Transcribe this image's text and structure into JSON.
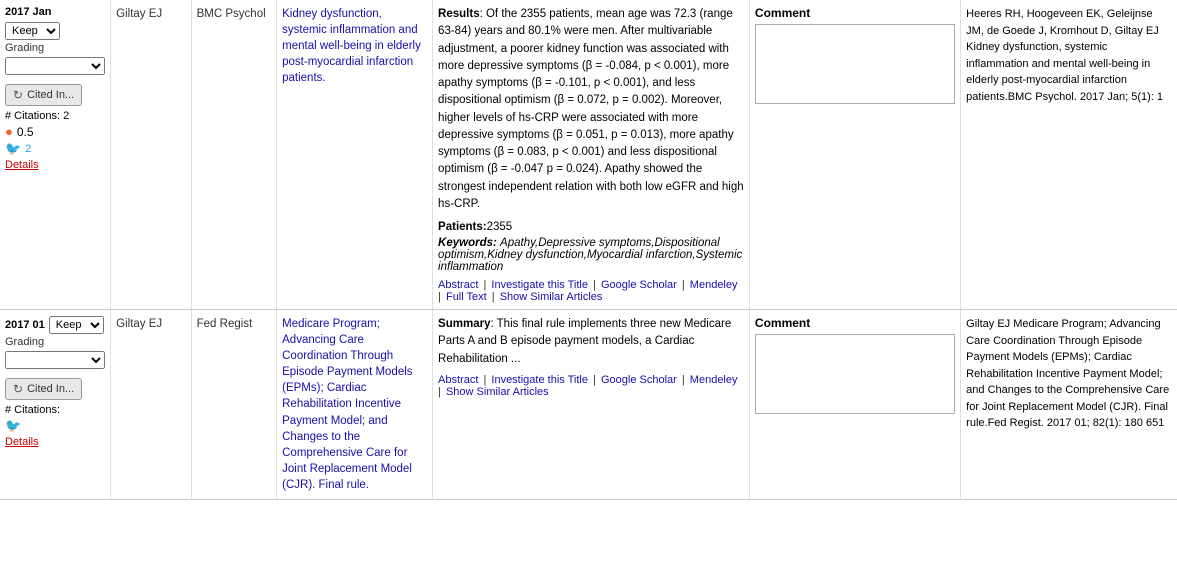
{
  "rows": [
    {
      "id": "row1",
      "date": "2017 Jan",
      "grading_label": "Grading",
      "keep_option": "Keep",
      "cited_btn": "Cited In...",
      "citations_count_label": "# Citations: 2",
      "score": "0.5",
      "twitter_count": "2",
      "details_label": "Details",
      "author": "Giltay EJ",
      "journal": "BMC Psychol",
      "title": "Kidney dysfunction, systemic inflammation and mental well-being in elderly post-myocardial infarction patients.",
      "summary_label": "Results",
      "summary_prefix": "Results",
      "summary_body": ": Of the 2355 patients, mean age was 72.3 (range 63-84) years and 80.1% were men. After multivariable adjustment, a poorer kidney function was associated with more depressive symptoms (β = -0.084, p < 0.001), more apathy symptoms (β = -0.101, p < 0.001), and less dispositional optimism (β = 0.072, p = 0.002). Moreover, higher levels of hs-CRP were associated with more depressive symptoms (β = 0.051, p = 0.013), more apathy symptoms (β = 0.083, p < 0.001) and less dispositional optimism (β = -0.047 p = 0.024). Apathy showed the strongest independent relation with both low eGFR and high hs-CRP.",
      "patients_label": "Patients:",
      "patients_value": "2355",
      "keywords_label": "Keywords:",
      "keywords_value": "Apathy,Depressive symptoms,Dispositional optimism,Kidney dysfunction,Myocardial infarction,Systemic inflammation",
      "links": [
        "Abstract",
        "Investigate this Title",
        "Google Scholar",
        "Mendeley",
        "Full Text"
      ],
      "show_similar": "Show Similar Articles",
      "comment_label": "Comment",
      "comment_placeholder": "",
      "citation_text": "Heeres RH, Hoogeveen EK, Geleijnse JM, de Goede J, Kromhout D, Giltay EJ Kidney dysfunction, systemic inflammation and mental well-being in elderly post-myocardial infarction patients.BMC Psychol. 2017 Jan; 5(1): 1"
    },
    {
      "id": "row2",
      "date": "2017 01",
      "grading_label": "Grading",
      "keep_option": "Keep",
      "cited_btn": "Cited In...",
      "citations_count_label": "# Citations:",
      "score": "",
      "twitter_count": "",
      "details_label": "Details",
      "author": "Giltay EJ",
      "journal": "Fed Regist",
      "title": "Medicare Program; Advancing Care Coordination Through Episode Payment Models (EPMs); Cardiac Rehabilitation Incentive Payment Model; and Changes to the Comprehensive Care for Joint Replacement Model (CJR). Final rule.",
      "summary_prefix": "Summary",
      "summary_body": ": This final rule implements three new Medicare Parts A and B episode payment models, a Cardiac Rehabilitation ...",
      "patients_label": "",
      "patients_value": "",
      "keywords_label": "",
      "keywords_value": "",
      "links": [
        "Abstract",
        "Investigate this Title",
        "Google Scholar",
        "Mendeley"
      ],
      "show_similar": "Show Similar Articles",
      "comment_label": "Comment",
      "comment_placeholder": "",
      "citation_text": "Giltay EJ Medicare Program; Advancing Care Coordination Through Episode Payment Models (EPMs); Cardiac Rehabilitation Incentive Payment Model; and Changes to the Comprehensive Care for Joint Replacement Model (CJR). Final rule.Fed Regist. 2017 01; 82(1): 180 651"
    }
  ],
  "icons": {
    "refresh": "↻",
    "circle": "●",
    "twitter": "🐦"
  }
}
